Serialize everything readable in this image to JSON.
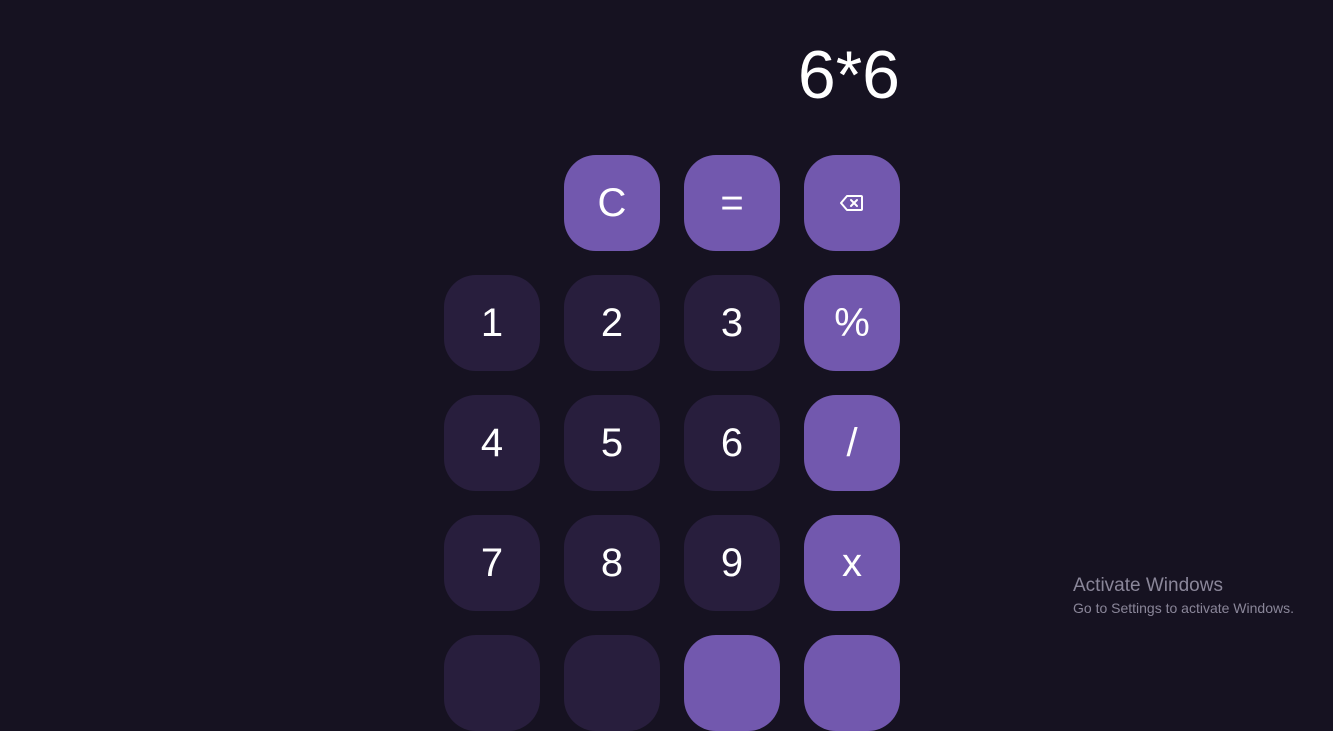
{
  "display": {
    "expression": "6*6"
  },
  "keys": {
    "clear": "C",
    "equals": "=",
    "backspace_icon": "backspace-icon",
    "one": "1",
    "two": "2",
    "three": "3",
    "percent": "%",
    "four": "4",
    "five": "5",
    "six": "6",
    "divide": "/",
    "seven": "7",
    "eight": "8",
    "nine": "9",
    "multiply": "x"
  },
  "colors": {
    "background": "#161221",
    "number_key": "#281e3d",
    "operator_key": "#7258ae",
    "text": "#ffffff"
  },
  "watermark": {
    "title": "Activate Windows",
    "subtitle": "Go to Settings to activate Windows."
  }
}
